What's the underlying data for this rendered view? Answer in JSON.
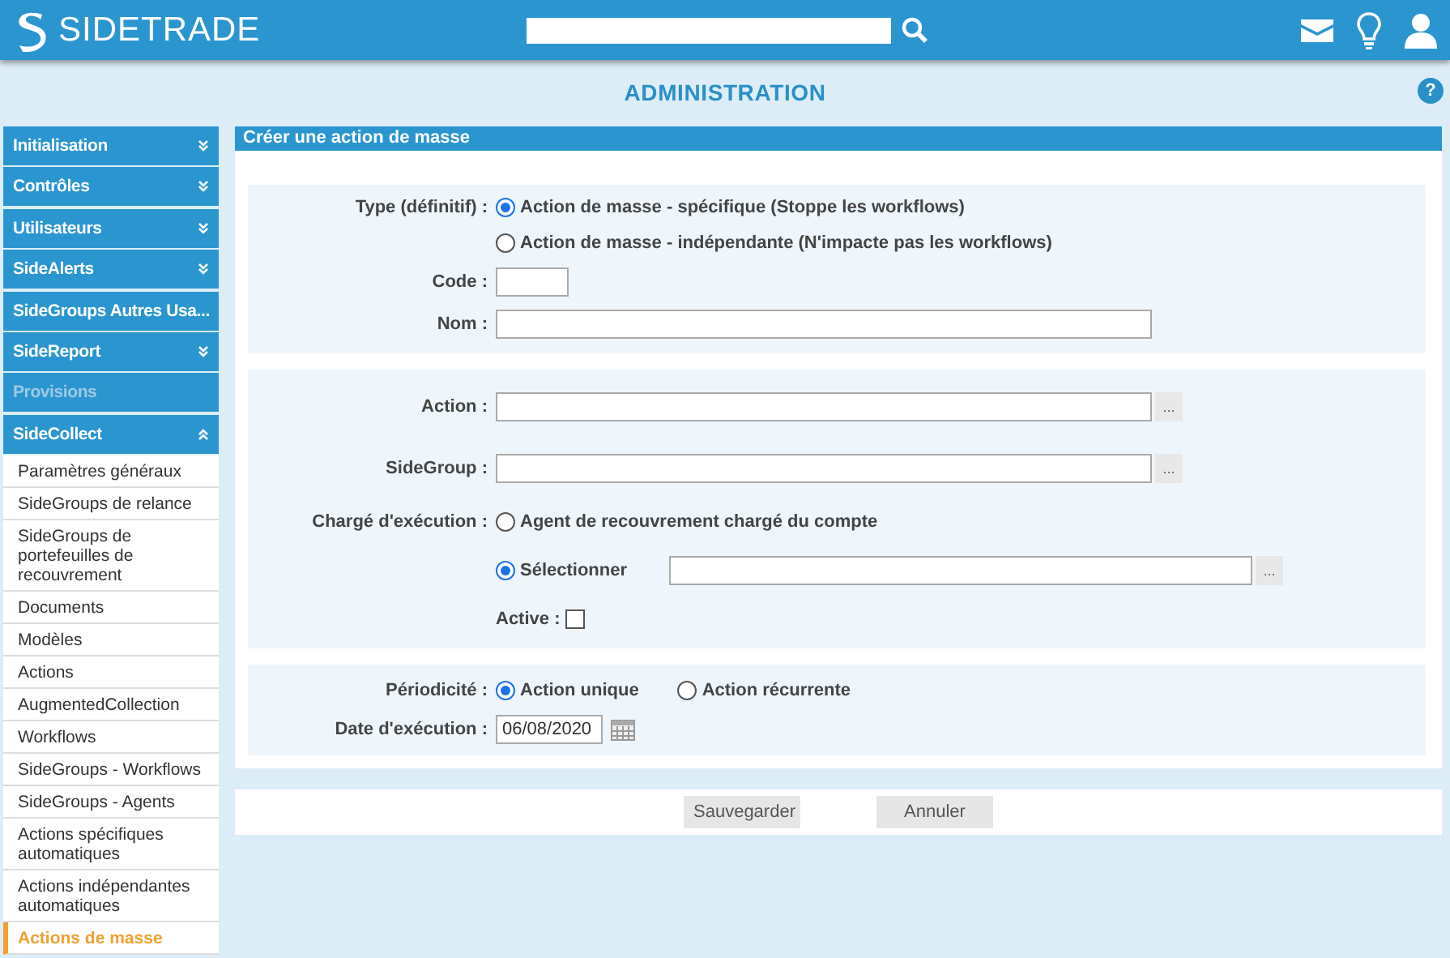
{
  "header": {
    "logo": "SIDETRADE"
  },
  "page_title": "ADMINISTRATION",
  "help": "?",
  "sidebar": {
    "sections": [
      {
        "label": "Initialisation",
        "kind": "folder",
        "expanded": false,
        "disabled": false
      },
      {
        "label": "Contrôles",
        "kind": "folder",
        "expanded": false,
        "disabled": false
      },
      {
        "label": "Utilisateurs",
        "kind": "folder",
        "expanded": false,
        "disabled": false
      },
      {
        "label": "SideAlerts",
        "kind": "folder",
        "expanded": false,
        "disabled": false
      },
      {
        "label": "SideGroups Autres Usa...",
        "kind": "link",
        "disabled": false
      },
      {
        "label": "SideReport",
        "kind": "folder",
        "expanded": false,
        "disabled": false
      },
      {
        "label": "Provisions",
        "kind": "link",
        "disabled": true
      },
      {
        "label": "SideCollect",
        "kind": "folder",
        "expanded": true,
        "disabled": false
      }
    ],
    "items": [
      {
        "label": "Paramètres généraux",
        "selected": false
      },
      {
        "label": "SideGroups de relance",
        "selected": false
      },
      {
        "label": "SideGroups de portefeuilles de recouvrement",
        "selected": false
      },
      {
        "label": "Documents",
        "selected": false
      },
      {
        "label": "Modèles",
        "selected": false
      },
      {
        "label": "Actions",
        "selected": false
      },
      {
        "label": "AugmentedCollection",
        "selected": false
      },
      {
        "label": "Workflows",
        "selected": false
      },
      {
        "label": "SideGroups - Workflows",
        "selected": false
      },
      {
        "label": "SideGroups - Agents",
        "selected": false
      },
      {
        "label": "Actions spécifiques automatiques",
        "selected": false
      },
      {
        "label": "Actions indépendantes automatiques",
        "selected": false
      },
      {
        "label": "Actions de masse",
        "selected": true
      }
    ]
  },
  "form": {
    "title": "Créer une action de masse",
    "sections": [
      {
        "rows": [
          {
            "kind": "radios_stacked",
            "label": "Type (définitif) :",
            "options": [
              {
                "label": "Action de masse - spécifique (Stoppe les workflows)",
                "selected": true
              },
              {
                "label": "Action de masse - indépendante (N'impacte pas les workflows)",
                "selected": false
              }
            ]
          },
          {
            "kind": "short_text",
            "label": "Code :"
          },
          {
            "kind": "text",
            "label": "Nom :"
          }
        ]
      },
      {
        "rows": [
          {
            "kind": "lookup",
            "label": "Action :",
            "button": "..."
          },
          {
            "kind": "lookup",
            "label": "SideGroup :",
            "button": "..."
          },
          {
            "kind": "radio_lookup",
            "label": "Chargé d'exécution :",
            "options": [
              {
                "label": "Agent de recouvrement chargé du compte",
                "selected": false
              },
              {
                "label": "Sélectionner",
                "selected": true,
                "button": "..."
              }
            ]
          },
          {
            "kind": "checkbox",
            "label": "Active :",
            "checked": false
          }
        ]
      },
      {
        "rows": [
          {
            "kind": "radios_inline",
            "label": "Périodicité :",
            "options": [
              {
                "label": "Action unique",
                "selected": true
              },
              {
                "label": "Action récurrente",
                "selected": false
              }
            ]
          },
          {
            "kind": "date",
            "label": "Date d'exécution :",
            "value": "06/08/2020"
          }
        ]
      }
    ]
  },
  "buttons": [
    "Sauvegarder",
    "Annuler"
  ]
}
